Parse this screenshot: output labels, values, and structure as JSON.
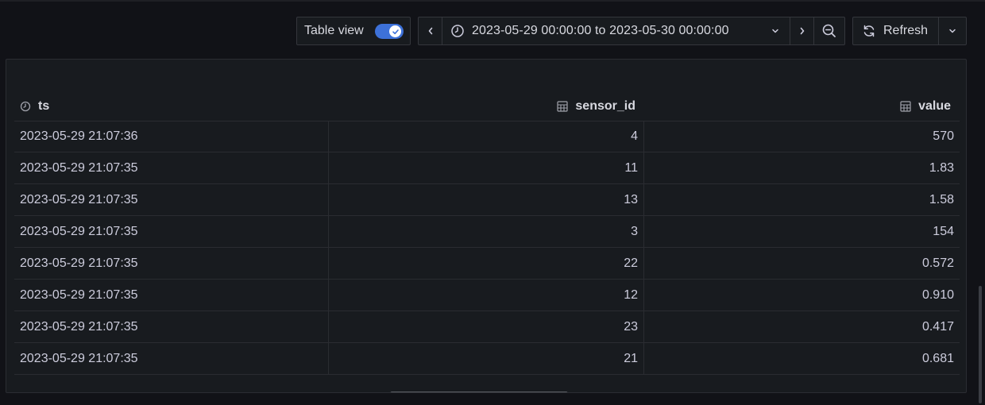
{
  "toolbar": {
    "table_view_label": "Table view",
    "table_view_on": true,
    "time_range": "2023-05-29 00:00:00 to 2023-05-30 00:00:00",
    "refresh_label": "Refresh"
  },
  "icons": {
    "time_prev": "chevron-left-icon",
    "time_next": "chevron-right-icon",
    "clock": "clock-icon",
    "zoom_out": "zoom-out-icon",
    "refresh": "refresh-icon",
    "menu": "chevron-down-icon",
    "column_time": "clock-icon",
    "column_number": "table-icon"
  },
  "colors": {
    "accent": "#3d71d9",
    "background": "#111217",
    "panel": "#181b1f",
    "text": "#ccccdc"
  },
  "table": {
    "columns": [
      "ts",
      "sensor_id",
      "value"
    ],
    "rows": [
      [
        "2023-05-29 21:07:36",
        "4",
        "570"
      ],
      [
        "2023-05-29 21:07:35",
        "11",
        "1.83"
      ],
      [
        "2023-05-29 21:07:35",
        "13",
        "1.58"
      ],
      [
        "2023-05-29 21:07:35",
        "3",
        "154"
      ],
      [
        "2023-05-29 21:07:35",
        "22",
        "0.572"
      ],
      [
        "2023-05-29 21:07:35",
        "12",
        "0.910"
      ],
      [
        "2023-05-29 21:07:35",
        "23",
        "0.417"
      ],
      [
        "2023-05-29 21:07:35",
        "21",
        "0.681"
      ]
    ]
  }
}
